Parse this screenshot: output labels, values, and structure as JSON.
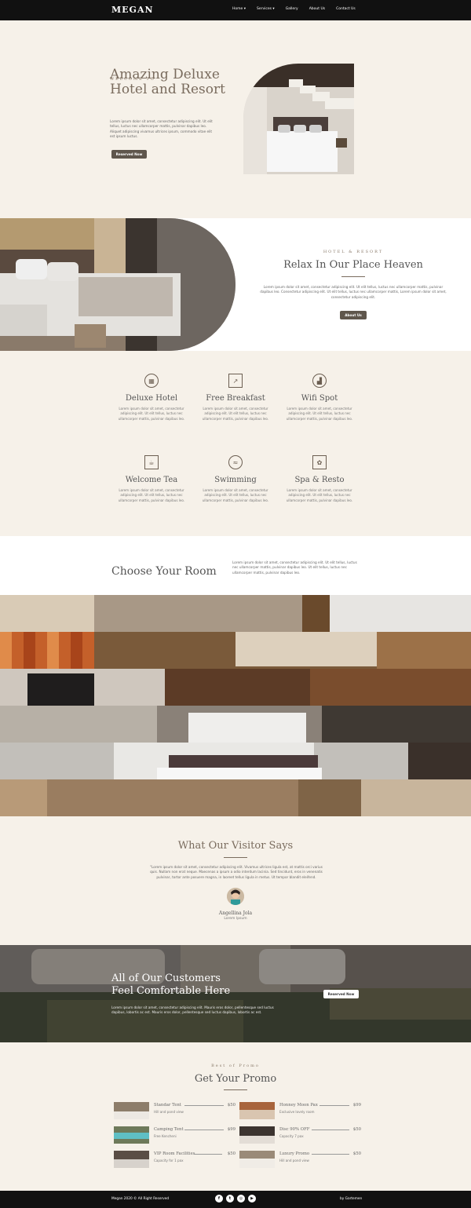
{
  "nav": {
    "brand": "MEGAN",
    "items": [
      {
        "label": "Home",
        "caret": "▾"
      },
      {
        "label": "Services",
        "caret": "▾"
      },
      {
        "label": "Gallery",
        "caret": ""
      },
      {
        "label": "About Us",
        "caret": ""
      },
      {
        "label": "Contact Us",
        "caret": ""
      }
    ]
  },
  "hero": {
    "eyebrow": "WELCOME TO",
    "title_line1": "Amazing Deluxe",
    "title_line2": "Hotel and Resort",
    "text": "Lorem ipsum dolor sit amet, consectetur adipiscing elit. Ut elit tellus, luctus nec ullamcorper mattis, pulvinar dapibus leo. Aliquet adipiscing vivamus ultrices ipsum, commodo vitae elit est ipsum luctus.",
    "button": "Reserved Now"
  },
  "about": {
    "eyebrow": "HOTEL & RESORT",
    "title": "Relax In Our Place Heaven",
    "text": "Lorem ipsum dolor sit amet, consectetur adipiscing elit. Ut elit tellus, luctus nec ullamcorper mattis, pulvinar dapibus leo. Consectetur adipiscing elit. Ut elit tellus, luctus nec ullamcorper mattis, Lorem ipsum dolor sit amet, consectetur adipiscing elit.",
    "button": "About Us"
  },
  "features": [
    {
      "title": "Deluxe Hotel",
      "icon": "building-icon",
      "glyph": "▦",
      "text": "Lorem ipsum dolor sit amet, consectetur adipiscing elit. Ut elit tellus, luctus nec ullamcorper mattis, pulvinar dapibus leo."
    },
    {
      "title": "Free Breakfast",
      "icon": "spoon-icon",
      "glyph": "↗",
      "text": "Lorem ipsum dolor sit amet, consectetur adipiscing elit. Ut elit tellus, luctus nec ullamcorper mattis, pulvinar dapibus leo."
    },
    {
      "title": "Wifi Spot",
      "icon": "signal-icon",
      "glyph": "▟",
      "text": "Lorem ipsum dolor sit amet, consectetur adipiscing elit. Ut elit tellus, luctus nec ullamcorper mattis, pulvinar dapibus leo."
    },
    {
      "title": "Welcome Tea",
      "icon": "tea-cup-icon",
      "glyph": "☕",
      "text": "Lorem ipsum dolor sit amet, consectetur adipiscing elit. Ut elit tellus, luctus nec ullamcorper mattis, pulvinar dapibus leo."
    },
    {
      "title": "Swimming",
      "icon": "swimmer-icon",
      "glyph": "≈",
      "text": "Lorem ipsum dolor sit amet, consectetur adipiscing elit. Ut elit tellus, luctus nec ullamcorper mattis, pulvinar dapibus leo."
    },
    {
      "title": "Spa & Resto",
      "icon": "spa-icon",
      "glyph": "✿",
      "text": "Lorem ipsum dolor sit amet, consectetur adipiscing elit. Ut elit tellus, luctus nec ullamcorper mattis, pulvinar dapibus leo."
    }
  ],
  "rooms": {
    "title": "Choose Your Room",
    "text": "Lorem ipsum dolor sit amet, consectetur adipiscing elit. Ut elit tellus, luctus nec ullamcorper mattis, pulvinar dapibus leo. Ut elit tellus, luctus nec ullamcorper mattis, pulvinar dapibus leo."
  },
  "testimonial": {
    "title": "What Our Visitor Says",
    "quote": "\"Lorem ipsum dolor sit amet, consectetur adipiscing elit. Vivamus ultrices ligula est, at mattis orci varius quis. Nullam non erat neque. Maecenas a ipsum a odio interdum lacinia. Sed tincidunt, eros in venenatis pulvinar, tortor ante posuere magna, in laoreet tellus ligula in metus. Ut tempor blandit eleifend.",
    "name": "Angellina Jola",
    "role": "Lorem Ipsum"
  },
  "cta": {
    "title_line1": "All of Our Customers",
    "title_line2": "Feel Comfortable Here",
    "text": "Lorem ipsum dolor sit amet, consectetur adipiscing elit. Mauris eros dolor, pellentesque sed luctus dapibus, lobortis ac est. Mauris eros dolor, pellentesque sed luctus dapibus, lobortis ac est.",
    "button": "Reserved Now"
  },
  "promo": {
    "eyebrow": "Best of Promo",
    "title": "Get Your Promo",
    "items": [
      {
        "name": "Standar Tent",
        "desc": "Hill and pond view",
        "price": "$50"
      },
      {
        "name": "Honney Moon Pax",
        "desc": "Exclusive lovely room",
        "price": "$99"
      },
      {
        "name": "Camping Tent",
        "desc": "Free Kencheni",
        "price": "$99"
      },
      {
        "name": "Disc 90% OFF",
        "desc": "Capacity 7 pax",
        "price": "$50"
      },
      {
        "name": "VIP Room Facilities",
        "desc": "Capacity for 1 pax",
        "price": "$50"
      },
      {
        "name": "Luxury Promo",
        "desc": "Hill and pond view",
        "price": "$50"
      }
    ]
  },
  "footer": {
    "copyright": "Megan 2020 © All Right Reserved",
    "credit": "by Gartemen",
    "social": [
      {
        "icon": "facebook-icon",
        "glyph": "f"
      },
      {
        "icon": "twitter-icon",
        "glyph": "t"
      },
      {
        "icon": "instagram-icon",
        "glyph": "◎"
      },
      {
        "icon": "youtube-icon",
        "glyph": "▶"
      }
    ]
  }
}
